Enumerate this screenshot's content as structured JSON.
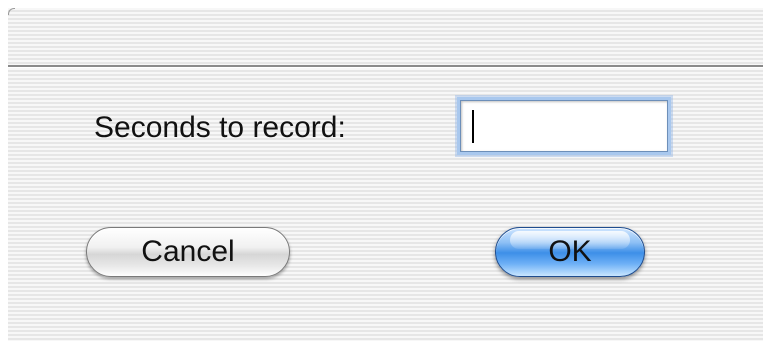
{
  "dialog": {
    "field_label": "Seconds to record:",
    "field_value": "",
    "cancel_label": "Cancel",
    "ok_label": "OK"
  },
  "colors": {
    "default_button": "#3d8fe8",
    "focus_ring": "#a9c8ee"
  }
}
